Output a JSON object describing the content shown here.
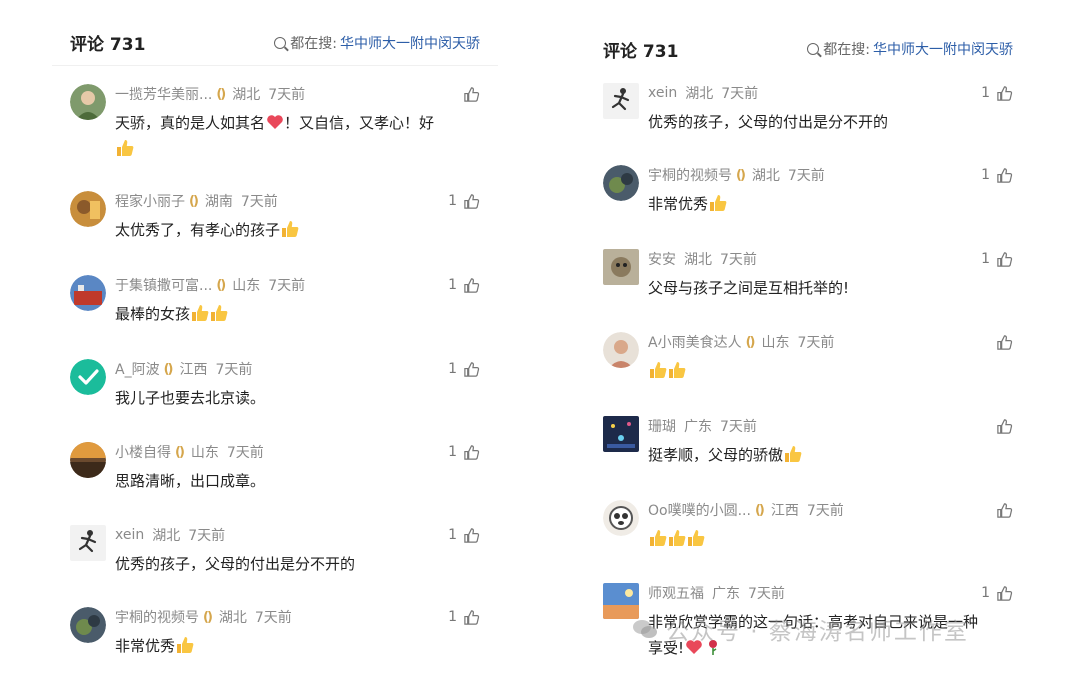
{
  "left": {
    "header": {
      "title": "评论 731",
      "search_prefix": "都在搜:",
      "search_keyword": "华中师大一附中闵天骄"
    },
    "comments": [
      {
        "name": "一揽芳华美丽...",
        "location": "湖北",
        "time": "7天前",
        "text": "天骄，真的是人如其名",
        "text2": "！又自信，又孝心！好",
        "like_count": ""
      },
      {
        "name": "程家小丽子",
        "location": "湖南",
        "time": "7天前",
        "text": "太优秀了，有孝心的孩子",
        "like_count": "1"
      },
      {
        "name": "于集镇撒可富...",
        "location": "山东",
        "time": "7天前",
        "text": "最棒的女孩",
        "like_count": "1"
      },
      {
        "name": "A_阿波",
        "location": "江西",
        "time": "7天前",
        "text": "我儿子也要去北京读。",
        "like_count": "1"
      },
      {
        "name": "小楼自得",
        "location": "山东",
        "time": "7天前",
        "text": "思路清晰，出口成章。",
        "like_count": "1"
      },
      {
        "name": "xein",
        "location": "湖北",
        "time": "7天前",
        "text": "优秀的孩子，父母的付出是分不开的",
        "like_count": "1"
      },
      {
        "name": "宇桐的视频号",
        "location": "湖北",
        "time": "7天前",
        "text": "非常优秀",
        "like_count": "1"
      }
    ]
  },
  "right": {
    "header": {
      "title": "评论 731",
      "search_prefix": "都在搜:",
      "search_keyword": "华中师大一附中闵天骄"
    },
    "comments": [
      {
        "name": "xein",
        "location": "湖北",
        "time": "7天前",
        "text": "优秀的孩子，父母的付出是分不开的",
        "like_count": "1"
      },
      {
        "name": "宇桐的视频号",
        "location": "湖北",
        "time": "7天前",
        "text": "非常优秀",
        "like_count": "1"
      },
      {
        "name": "安安",
        "location": "湖北",
        "time": "7天前",
        "text": "父母与孩子之间是互相托举的!",
        "like_count": "1"
      },
      {
        "name": "A小雨美食达人",
        "location": "山东",
        "time": "7天前",
        "text": "",
        "like_count": ""
      },
      {
        "name": "珊瑚",
        "location": "广东",
        "time": "7天前",
        "text": "挺孝顺，父母的骄傲",
        "like_count": ""
      },
      {
        "name": "Oo噗噗的小圆...",
        "location": "江西",
        "time": "7天前",
        "text": "",
        "like_count": ""
      },
      {
        "name": "师观五福",
        "location": "广东",
        "time": "7天前",
        "text": "非常欣赏学霸的这一句话：高考对自己来说是一种",
        "text2": "享受!",
        "like_count": "1"
      }
    ]
  },
  "watermark": {
    "text": "公众号 · 蔡海涛名师工作室"
  },
  "colors": {
    "keyword": "#2d5ea8",
    "meta": "#8a8a8a",
    "badge": "#d5a64c"
  }
}
